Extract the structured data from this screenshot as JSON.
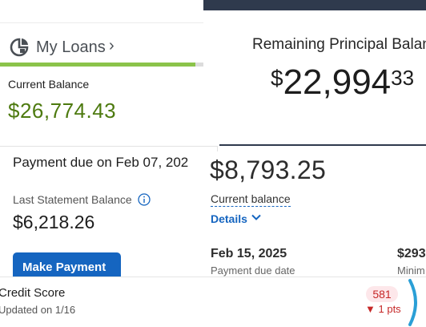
{
  "loans": {
    "title": "My Loans",
    "chevron": "›",
    "icon": "loan-clock-icon",
    "progress_fraction": 0.96,
    "progress_color": "#8bc34a",
    "current_balance_label": "Current Balance",
    "current_balance_value": "$26,774.43",
    "value_color": "#4d7a0f"
  },
  "principal": {
    "title": "Remaining Principal Balan",
    "currency": "$",
    "amount_main": "22,994",
    "amount_cents": "33",
    "bar_color": "#2f3a4d"
  },
  "payment": {
    "title": "Payment due on Feb 07, 202",
    "statement_label": "Last Statement Balance",
    "info_icon": "info-circle-icon",
    "statement_value": "$6,218.26",
    "button_label": "Make Payment",
    "button_color": "#1565c0"
  },
  "balance": {
    "value": "$8,793.25",
    "label": "Current balance",
    "details_label": "Details",
    "details_icon": "chevron-down-icon",
    "due_date": "Feb 15, 2025",
    "due_label": "Payment due date",
    "min_value": "$293",
    "min_label": "Minim"
  },
  "credit": {
    "title": "Credit Score",
    "updated": "Updated on 1/16",
    "score": "581",
    "change_arrow": "▼",
    "change_text": "1 pts",
    "accent_color": "#c62828"
  }
}
